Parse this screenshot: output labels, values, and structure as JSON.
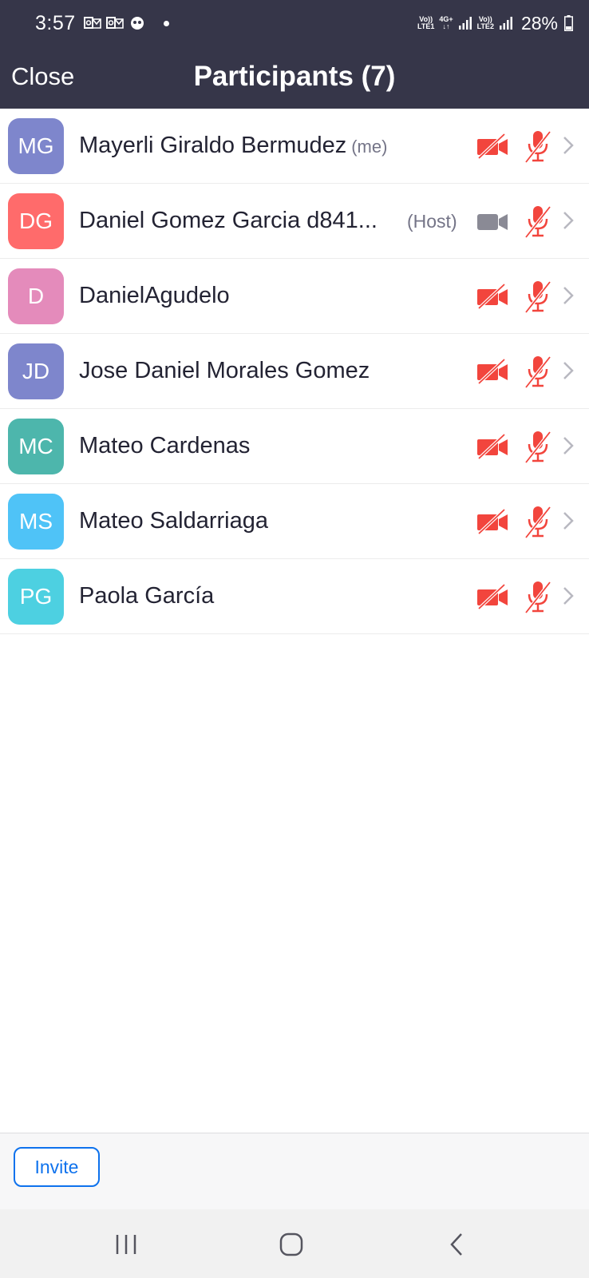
{
  "status_bar": {
    "time": "3:57",
    "notification_icons": [
      "outlook-icon",
      "outlook-icon",
      "messenger-icon"
    ],
    "net1_top": "Vo))",
    "net1_bottom": "LTE1",
    "net2_top": "4G+",
    "net3_top": "Vo))",
    "net3_bottom": "LTE2",
    "battery_percent": "28%"
  },
  "header": {
    "close_label": "Close",
    "title": "Participants (7)"
  },
  "participants": [
    {
      "initials": "MG",
      "name": "Mayerli Giraldo Bermudez",
      "tag": "(me)",
      "color": "#7e86cc",
      "video": "off",
      "audio": "muted"
    },
    {
      "initials": "DG",
      "name": "Daniel Gomez Garcia d841...",
      "tag": "(Host)",
      "color": "#ff6b6b",
      "video": "on",
      "audio": "muted"
    },
    {
      "initials": "D",
      "name": "DanielAgudelo",
      "tag": "",
      "color": "#e48bbb",
      "video": "off",
      "audio": "muted"
    },
    {
      "initials": "JD",
      "name": "Jose Daniel Morales Gomez",
      "tag": "",
      "color": "#7e86cc",
      "video": "off",
      "audio": "muted"
    },
    {
      "initials": "MC",
      "name": "Mateo Cardenas",
      "tag": "",
      "color": "#4db6ac",
      "video": "off",
      "audio": "muted"
    },
    {
      "initials": "MS",
      "name": "Mateo Saldarriaga",
      "tag": "",
      "color": "#4fc3f7",
      "video": "off",
      "audio": "muted"
    },
    {
      "initials": "PG",
      "name": "Paola García",
      "tag": "",
      "color": "#4dd0e1",
      "video": "off",
      "audio": "muted"
    }
  ],
  "bottom_bar": {
    "invite_label": "Invite"
  },
  "nav_bar": {
    "icons": [
      "recent-apps-icon",
      "home-icon",
      "back-icon"
    ]
  },
  "colors": {
    "header_bg": "#363649",
    "muted_red": "#f2453d",
    "video_on_gray": "#8a8a95",
    "accent_blue": "#0e72ed"
  }
}
